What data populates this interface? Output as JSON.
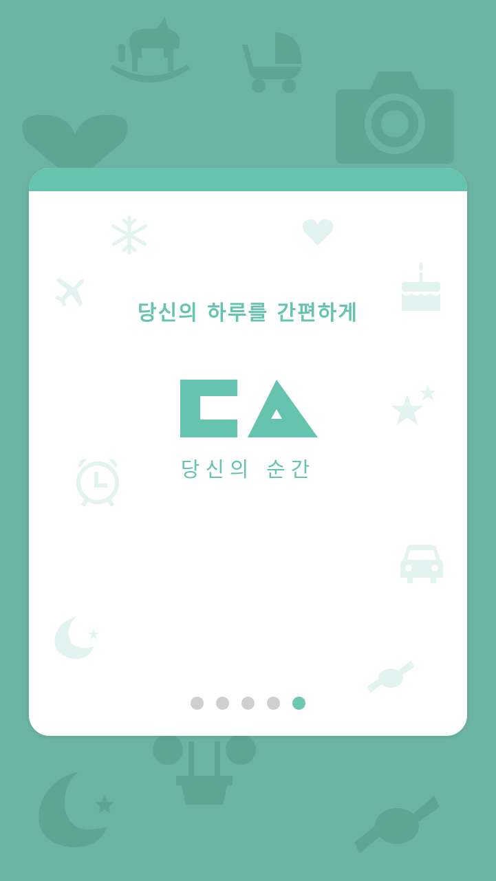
{
  "colors": {
    "background": "#6bb3a4",
    "background_icons": "#5fa596",
    "accent": "#66c3b0",
    "card": "#ffffff",
    "decor_icons": "#e3f4f0",
    "dot_inactive": "#cfcfcf",
    "dot_active": "#6dc7b3"
  },
  "background_icons": [
    "rocking-horse-icon",
    "stroller-icon",
    "camera-icon",
    "heart-icon",
    "flower-pot-icon",
    "moon-star-icon",
    "candy-icon"
  ],
  "card": {
    "decor_icons": [
      "snowflake-icon",
      "heart-icon",
      "airplane-icon",
      "cake-icon",
      "stars-icon",
      "alarm-clock-icon",
      "car-icon",
      "moon-star-icon",
      "candy-icon"
    ],
    "tagline": "당신의 하루를 간편하게",
    "logo_subtitle": "당신의 순간"
  },
  "pager": {
    "total": 5,
    "active_index": 5
  }
}
